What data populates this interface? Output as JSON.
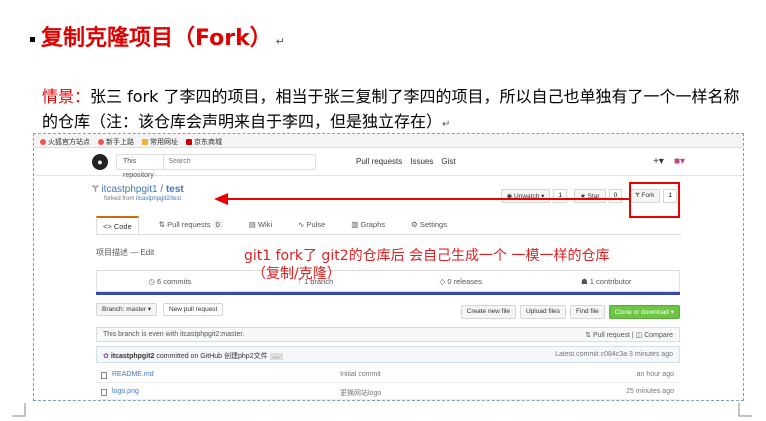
{
  "heading": {
    "text": "复制克隆项目（Fork）",
    "mark": "↵"
  },
  "scenario": {
    "lead": "情景：",
    "body": "张三 fork 了李四的项目，相当于张三复制了李四的项目，所以自己也单独有了一个一样名称的仓库（注：该仓库会声明来自于李四，但是独立存在）",
    "mark": "↵"
  },
  "bookmarks": [
    "火狐官方站点",
    "新手上路",
    "常用网址",
    "京东商城"
  ],
  "topbar": {
    "search_scope": "This repository",
    "search_placeholder": "Search",
    "nav": [
      "Pull requests",
      "Issues",
      "Gist"
    ]
  },
  "repo": {
    "owner": "itcastphpgit1",
    "name": "test",
    "forked_prefix": "forked from",
    "forked_from": "itcastphpgit2/test",
    "unwatch": "Unwatch ▾",
    "watch_count": "1",
    "star": "★ Star",
    "star_count": "0",
    "fork": "Fork",
    "fork_count": "1"
  },
  "tabs": [
    "<> Code",
    "Pull requests",
    "Wiki",
    "Pulse",
    "Graphs",
    "Settings"
  ],
  "pr_count": "0",
  "description_label": "项目描述 — Edit",
  "stats": [
    "6 commits",
    "1 branch",
    "0 releases",
    "1 contributor"
  ],
  "branch": {
    "label": "Branch: master ▾",
    "new_pr": "New pull request",
    "create_file": "Create new file",
    "upload": "Upload files",
    "find": "Find file",
    "clone": "Clone or download ▾"
  },
  "even_note": "This branch is even with itcastphpgit2:master.",
  "even_links": [
    "Pull request",
    "Compare"
  ],
  "commit": {
    "author": "itcastphpgit2",
    "text": "committed on GitHub 创建php2文件",
    "latest": "Latest commit c084c3a 3 minutes ago"
  },
  "files": [
    {
      "name": "README.md",
      "msg": "Initial commit",
      "age": "an hour ago"
    },
    {
      "name": "logo.png",
      "msg": "更换网站logo",
      "age": "25 minutes ago"
    }
  ],
  "annotation": {
    "line1": "git1   fork了  git2的仓库后  会自己生成一个  一模一样的仓库",
    "line2": "（复制/克隆）"
  },
  "colors": {
    "accent_red": "#e00000",
    "link_blue": "#4078c0",
    "green": "#6cc644"
  }
}
